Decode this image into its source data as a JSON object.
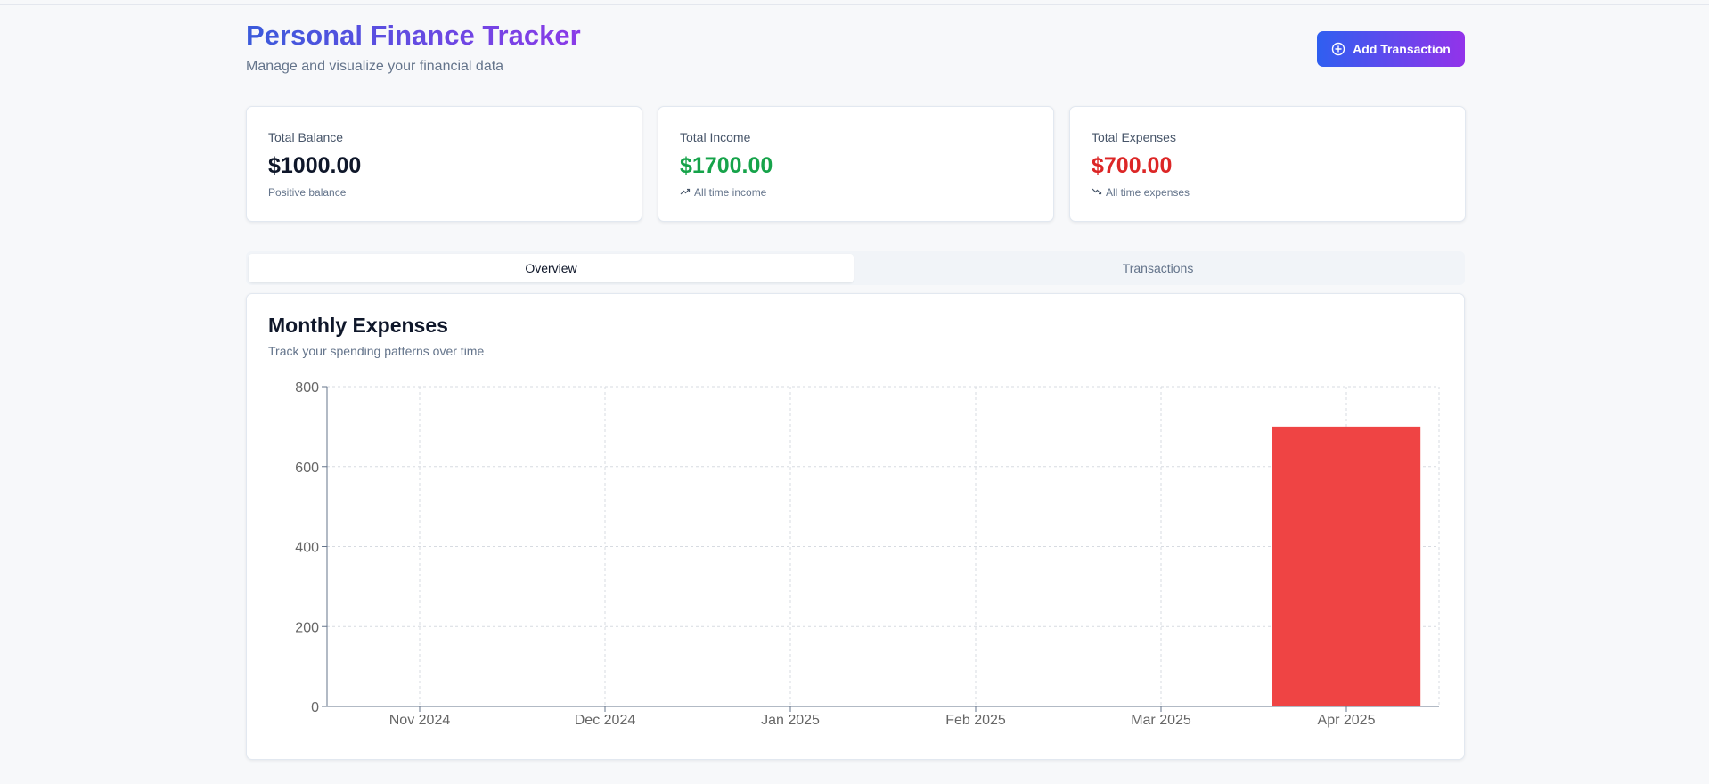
{
  "header": {
    "title": "Personal Finance Tracker",
    "subtitle": "Manage and visualize your financial data",
    "add_button_label": "Add Transaction",
    "add_button_icon": "plus-circle-icon"
  },
  "summary_cards": [
    {
      "label": "Total Balance",
      "value": "$1000.00",
      "note": "Positive balance",
      "value_color": "#0f172a",
      "icon": ""
    },
    {
      "label": "Total Income",
      "value": "$1700.00",
      "note": "All time income",
      "value_color": "#16a34a",
      "icon": "trending-up-icon"
    },
    {
      "label": "Total Expenses",
      "value": "$700.00",
      "note": "All time expenses",
      "value_color": "#dc2626",
      "icon": "trending-down-icon"
    }
  ],
  "tabs": [
    {
      "label": "Overview",
      "active": true
    },
    {
      "label": "Transactions",
      "active": false
    }
  ],
  "chart_card": {
    "title": "Monthly Expenses",
    "subtitle": "Track your spending patterns over time"
  },
  "chart_data": {
    "type": "bar",
    "categories": [
      "Nov 2024",
      "Dec 2024",
      "Jan 2025",
      "Feb 2025",
      "Mar 2025",
      "Apr 2025"
    ],
    "values": [
      0,
      0,
      0,
      0,
      0,
      700
    ],
    "ylim": [
      0,
      800
    ],
    "yticks": [
      0,
      200,
      400,
      600,
      800
    ],
    "grid": true,
    "bar_color": "#ef4444",
    "title": "",
    "xlabel": "",
    "ylabel": ""
  }
}
